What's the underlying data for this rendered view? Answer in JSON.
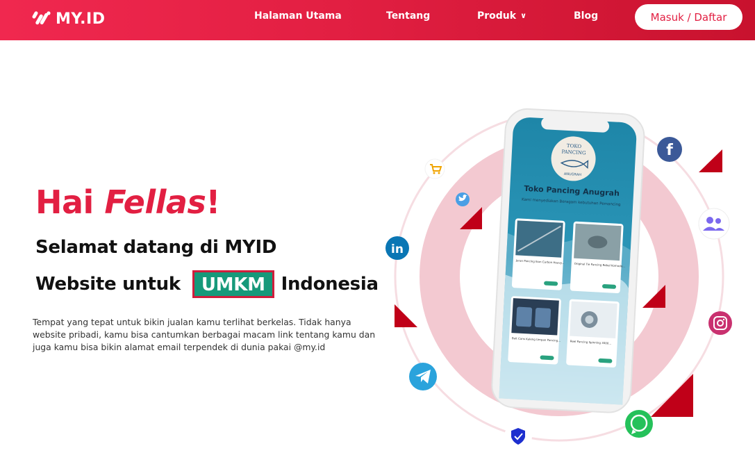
{
  "brand": {
    "name": "MY.ID"
  },
  "nav": {
    "items": [
      {
        "label": "Halaman Utama"
      },
      {
        "label": "Tentang"
      },
      {
        "label": "Produk"
      },
      {
        "label": "Blog"
      }
    ],
    "login_label": "Masuk / Daftar"
  },
  "hero": {
    "greeting_prefix": "Hai ",
    "greeting_em": "Fellas",
    "greeting_suffix": "!",
    "line1": "Selamat datang di MYID",
    "line2_prefix": "Website untuk",
    "line2_badge": "UMKM",
    "line2_suffix": "Indonesia",
    "description": "Tempat yang tepat untuk bikin jualan kamu terlihat berkelas. Tidak hanya website pribadi, kamu bisa cantumkan berbagai macam link tentang kamu dan juga kamu bisa bikin alamat email terpendek di dunia pakai @my.id"
  },
  "phone": {
    "shop_logo_line1": "TOKO",
    "shop_logo_line2": "PANCING",
    "shop_logo_line3": "ANUGRAH",
    "shop_name": "Toko Pancing Anugrah",
    "shop_tagline": "Kami menyediakan Beragam kebutuhan Pemancing",
    "products": [
      {
        "name": "Joran Pancing Ikan Carbon Heavy..."
      },
      {
        "name": "Original Tie Pancing Rebel Komodo..."
      },
      {
        "name": "Bait Cans Kaleng Umpan Pancing..."
      },
      {
        "name": "Reel Pancing Spinning 3000..."
      }
    ]
  },
  "colors": {
    "brand_red": "#e21f42",
    "badge_green": "#16997a",
    "facebook": "#3b5998",
    "linkedin": "#0a76b4",
    "telegram": "#2aa3dc",
    "whatsapp": "#25c15a",
    "instagram": "#c9316f"
  },
  "icons": [
    "facebook-icon",
    "twitter-icon",
    "linkedin-icon",
    "telegram-icon",
    "whatsapp-icon",
    "instagram-icon",
    "users-icon",
    "cart-icon",
    "shield-check-icon"
  ]
}
